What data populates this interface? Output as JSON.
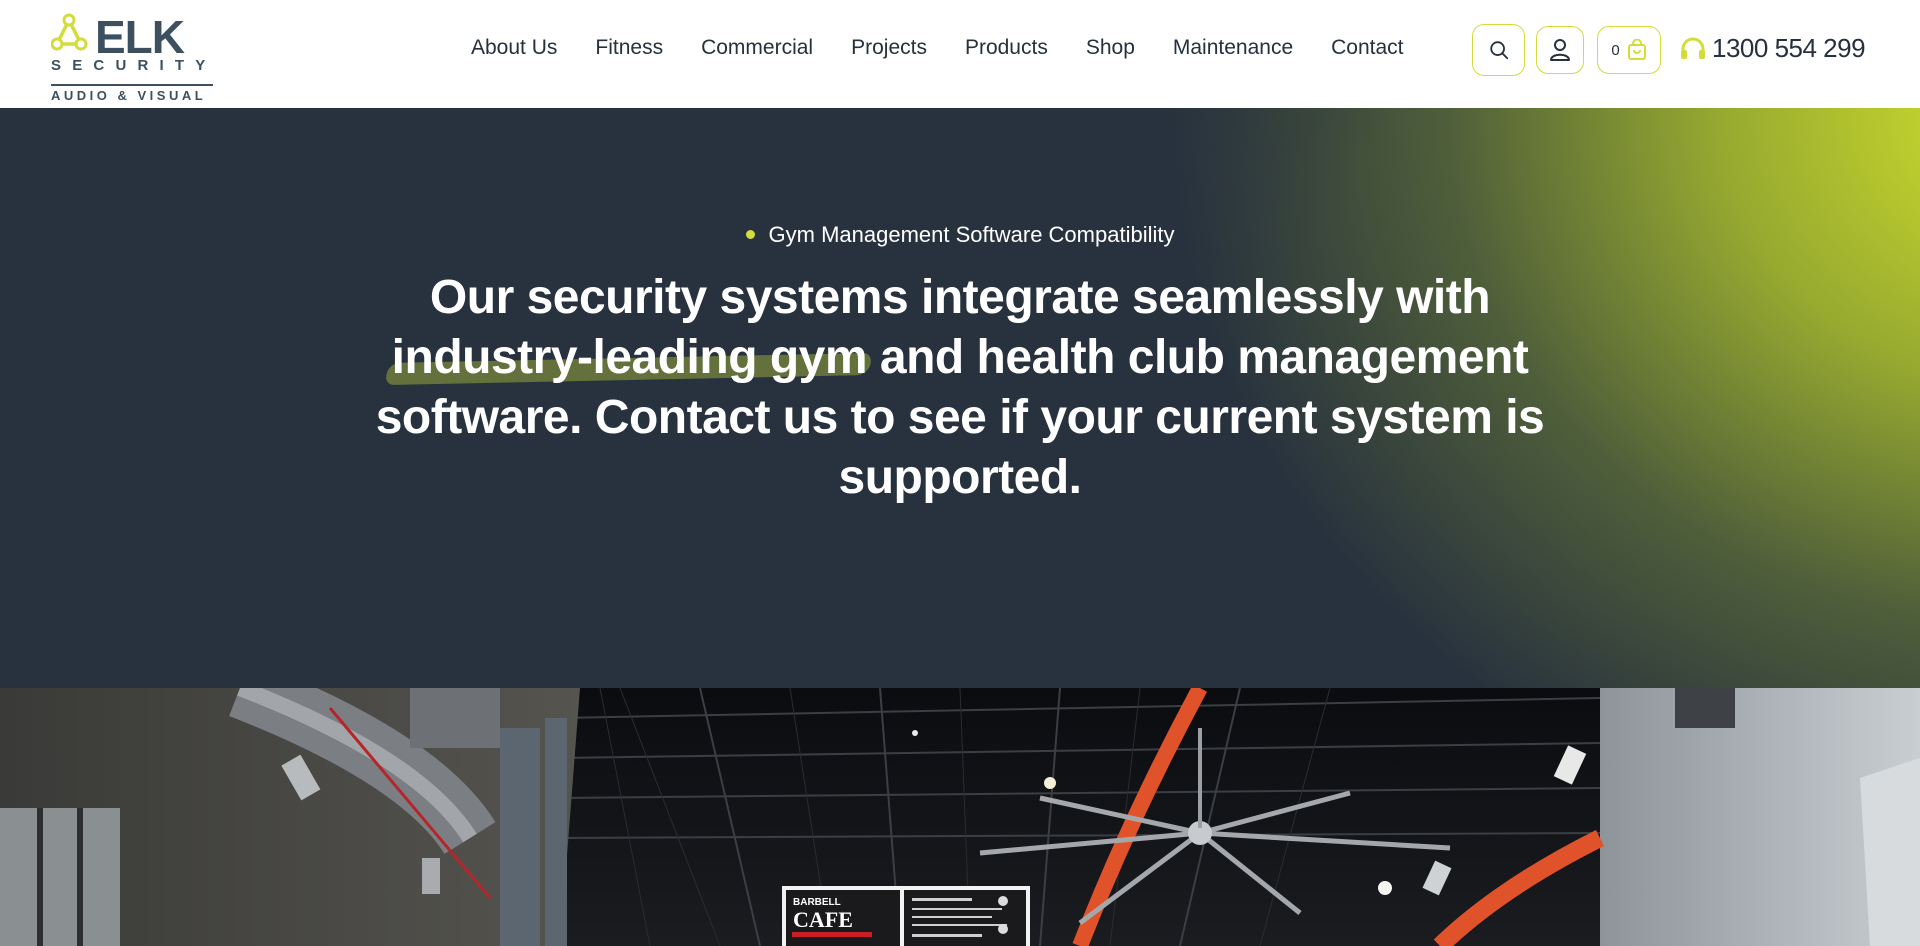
{
  "brand": {
    "word": "ELK",
    "line1": "SECURITY",
    "line2": "AUDIO & VISUAL",
    "accent": "#d3dc3a",
    "dark": "#28323e"
  },
  "nav": {
    "items": [
      {
        "label": "About Us"
      },
      {
        "label": "Fitness"
      },
      {
        "label": "Commercial"
      },
      {
        "label": "Projects"
      },
      {
        "label": "Products"
      },
      {
        "label": "Shop"
      },
      {
        "label": "Maintenance"
      },
      {
        "label": "Contact"
      }
    ]
  },
  "header": {
    "search_icon": "search-icon",
    "account_icon": "user-icon",
    "cart_count": "0",
    "cart_icon": "shopping-bag-icon",
    "phone_icon": "headset-icon",
    "phone": "1300 554 299"
  },
  "hero": {
    "eyebrow": "Gym Management Software Compatibility",
    "title_highlight": "industry-leading gym",
    "title_line1": "Our security systems integrate seamlessly with",
    "title_after_highlight": " and health club management",
    "title_rest": "software. Contact us to see if your current system is supported."
  },
  "photo": {
    "sign_line1": "BARBELL",
    "sign_line2": "CAFE"
  }
}
